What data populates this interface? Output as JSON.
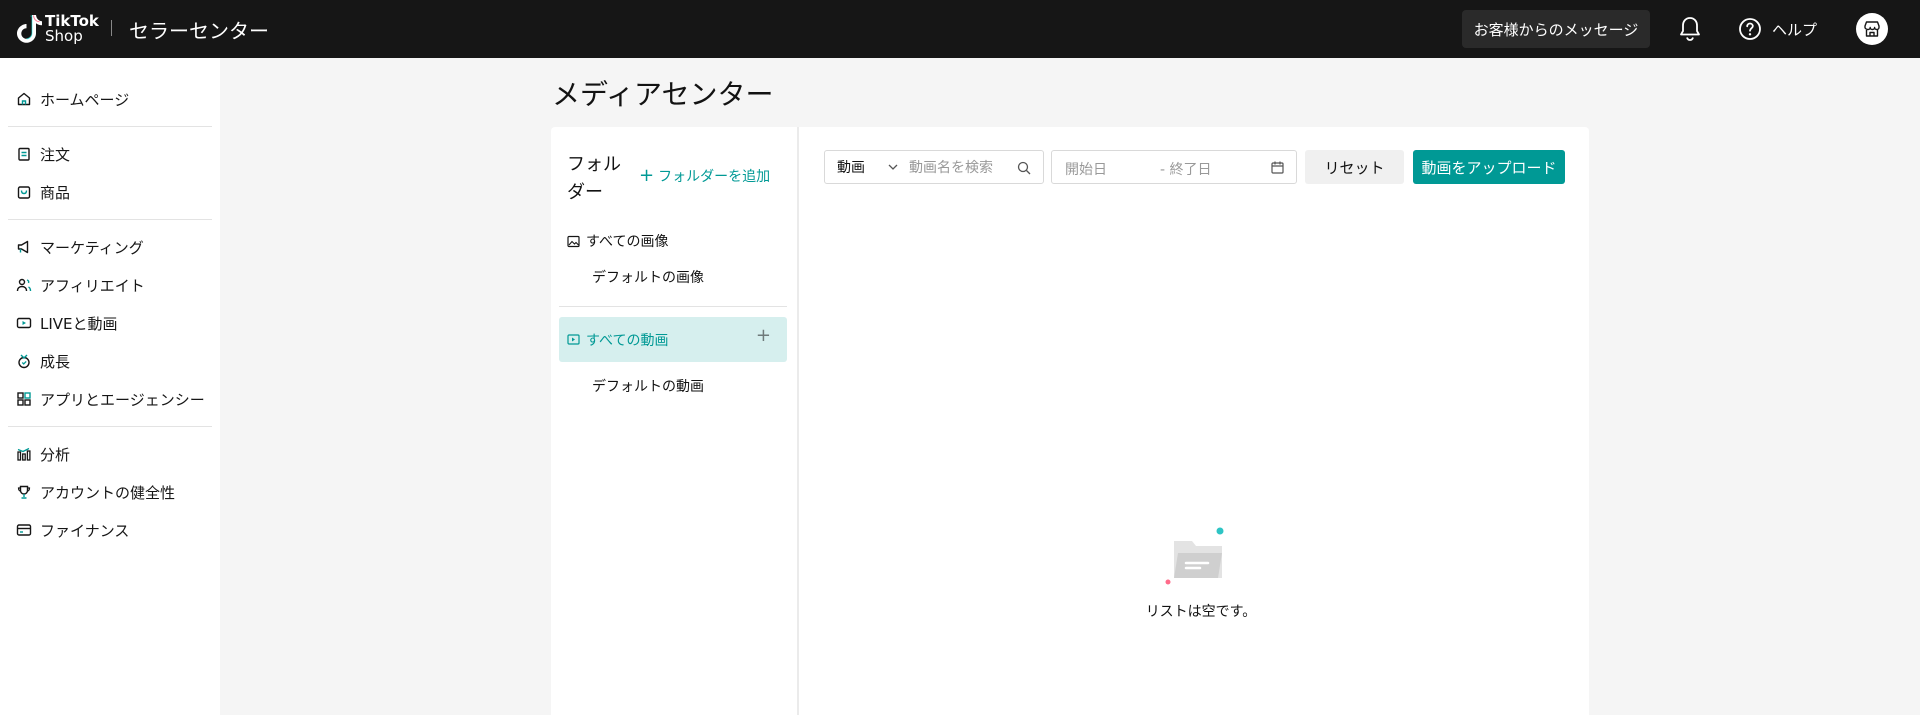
{
  "topbar": {
    "logo_line1": "TikTok",
    "logo_line2": "Shop",
    "app_title": "セラーセンター",
    "messages_label": "お客様からのメッセージ",
    "help_label": "ヘルプ"
  },
  "sidebar": {
    "items": [
      {
        "label": "ホームページ",
        "icon": "home-icon"
      },
      {
        "label": "注文",
        "icon": "clipboard-icon"
      },
      {
        "label": "商品",
        "icon": "bag-icon"
      },
      {
        "label": "マーケティング",
        "icon": "megaphone-icon"
      },
      {
        "label": "アフィリエイト",
        "icon": "people-icon"
      },
      {
        "label": "LIVEと動画",
        "icon": "video-icon"
      },
      {
        "label": "成長",
        "icon": "growth-icon"
      },
      {
        "label": "アプリとエージェンシー",
        "icon": "apps-icon"
      },
      {
        "label": "分析",
        "icon": "chart-icon"
      },
      {
        "label": "アカウントの健全性",
        "icon": "trophy-icon"
      },
      {
        "label": "ファイナンス",
        "icon": "card-icon"
      }
    ]
  },
  "main": {
    "page_title": "メディアセンター",
    "folders": {
      "title": "フォルダー",
      "add_label": "フォルダーを追加",
      "all_images": "すべての画像",
      "default_images": "デフォルトの画像",
      "all_videos": "すべての動画",
      "default_videos": "デフォルトの動画"
    },
    "toolbar": {
      "type_value": "動画",
      "search_placeholder": "動画名を検索",
      "start_placeholder": "開始日",
      "end_placeholder": "- 終了日",
      "reset_label": "リセット",
      "upload_label": "動画をアップロード"
    },
    "empty_text": "リストは空です。"
  },
  "colors": {
    "accent": "#009995",
    "topbar": "#161616",
    "active_folder_bg": "#d6efee"
  }
}
